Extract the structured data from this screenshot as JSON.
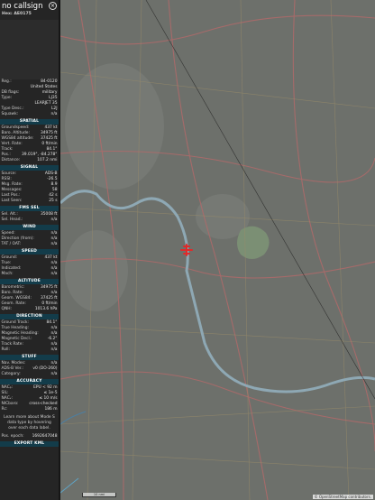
{
  "header": {
    "callsign": "no callsign",
    "hex": "Hex: AE0175",
    "close_icon": "close-icon"
  },
  "aircraft": {
    "reg": "84-0120",
    "country": "United States",
    "db_flags": "military",
    "type": "LJ35",
    "type_name": "LEARJET 35",
    "type_desc": "L2J",
    "squawk": "n/a"
  },
  "sections": {
    "spatial": "SPATIAL",
    "signal": "SIGNAL",
    "fms_sel": "FMS SEL",
    "wind": "WIND",
    "speed": "SPEED",
    "altitude": "ALTITUDE",
    "direction": "DIRECTION",
    "stuff": "STUFF",
    "accuracy": "ACCURACY",
    "export": "EXPORT KML"
  },
  "labels": {
    "reg": "Reg.:",
    "db_flags": "DB flags:",
    "type": "Type:",
    "type_desc": "Type Desc.:",
    "squawk": "Squawk:",
    "groundspeed": "Groundspeed:",
    "baro_alt": "Baro. Altitude:",
    "wgs84_alt": "WGS84 altitude:",
    "vert_rate": "Vert. Rate:",
    "track": "Track:",
    "pos": "Pos.:",
    "distance": "Distance:",
    "source": "Source:",
    "rssi": "RSSI:",
    "msg_rate": "Msg. Rate:",
    "messages": "Messages:",
    "last_pos": "Last Pos.:",
    "last_seen": "Last Seen:",
    "sel_alt": "Sel. Alt.:",
    "sel_head": "Sel. Head.:",
    "speed_w": "Speed:",
    "dir_from": "Direction (from):",
    "tat_oat": "TAT / OAT:",
    "ground": "Ground:",
    "true": "True:",
    "indicated": "Indicated:",
    "mach": "Mach:",
    "barometric": "Barometric:",
    "baro_rate": "Baro. Rate:",
    "geom_wgs84": "Geom. WGS84:",
    "geom_rate": "Geom. Rate:",
    "qnh": "QNH:",
    "ground_track": "Ground Track:",
    "true_heading": "True Heading:",
    "mag_heading": "Magnetic Heading:",
    "mag_decl": "Magnetic Decl.:",
    "track_rate": "Track Rate:",
    "roll": "Roll:",
    "nav_modes": "Nav. Modes:",
    "adsb_ver": "ADS-B Ver.:",
    "category": "Category:",
    "nacp": "NACₚ:",
    "sil": "SIL:",
    "nacv": "NACᵥ:",
    "nic_baro": "NICbaro:",
    "rc": "Rc:",
    "pos_epoch": "Pos. epoch:"
  },
  "spatial": {
    "groundspeed": "437 kt",
    "baro_alt": "34975 ft",
    "wgs84_alt": "37425 ft",
    "vert_rate": "0 ft/min",
    "track": "84.1°",
    "pos": "39.019°, -84.278°",
    "distance": "107.2 nmi"
  },
  "signal": {
    "source": "ADS-B",
    "rssi": "-26.5",
    "msg_rate": "8.9",
    "messages": "58",
    "last_pos": "42 s",
    "last_seen": "25 s"
  },
  "fms": {
    "sel_alt": "35008 ft",
    "sel_head": "n/a"
  },
  "wind": {
    "speed": "n/a",
    "dir_from": "n/a",
    "tat_oat": "n/a"
  },
  "speed": {
    "ground": "437 kt",
    "true": "n/a",
    "indicated": "n/a",
    "mach": "n/a"
  },
  "altitude": {
    "barometric": "34975 ft",
    "baro_rate": "n/a",
    "geom_wgs84": "37425 ft",
    "geom_rate": "0 ft/min",
    "qnh": "1013.6 hPa"
  },
  "direction": {
    "ground_track": "84.1°",
    "true_heading": "n/a",
    "mag_heading": "n/a",
    "mag_decl": "-6.2°",
    "track_rate": "n/a",
    "roll": "n/a"
  },
  "stuff": {
    "nav_modes": "n/a",
    "adsb_ver": "v0 (DO-260)",
    "category": "n/a"
  },
  "accuracy": {
    "nacp": "EPU < 92 m",
    "sil": "≤ 1e-5",
    "nacv": "≤ 10 m/s",
    "nic_baro": "cross-checked",
    "rc": "186 m"
  },
  "note": "Learn more about Mode S data type by hovering over each data label.",
  "pos_epoch": "1692647048",
  "map": {
    "attribution": "© OpenStreetMap contributors.",
    "scale_label": "10 nmi",
    "aircraft_color": "#e02a2a",
    "river_color": "#8ea8b4"
  }
}
